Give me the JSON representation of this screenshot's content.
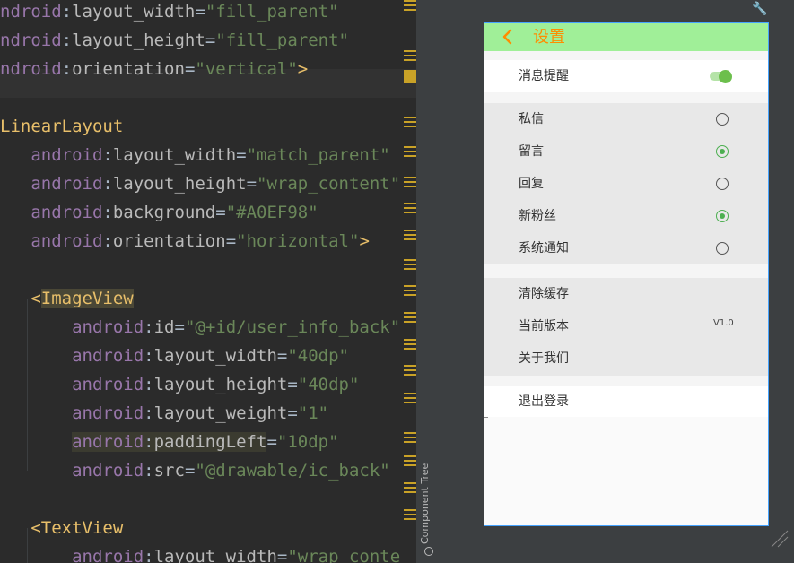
{
  "editor": {
    "lines": [
      [
        {
          "c": "ns",
          "t": "ndroid"
        },
        {
          "c": "",
          "t": ":"
        },
        {
          "c": "attr",
          "t": "layout_width"
        },
        {
          "c": "",
          "t": "="
        },
        {
          "c": "str",
          "t": "\"fill_parent\""
        }
      ],
      [
        {
          "c": "ns",
          "t": "ndroid"
        },
        {
          "c": "",
          "t": ":"
        },
        {
          "c": "attr",
          "t": "layout_height"
        },
        {
          "c": "",
          "t": "="
        },
        {
          "c": "str",
          "t": "\"fill_parent\""
        }
      ],
      [
        {
          "c": "ns",
          "t": "ndroid"
        },
        {
          "c": "",
          "t": ":"
        },
        {
          "c": "attr",
          "t": "orientation"
        },
        {
          "c": "",
          "t": "="
        },
        {
          "c": "str",
          "t": "\"vertical\""
        },
        {
          "c": "tag",
          "t": ">"
        }
      ],
      [],
      [
        {
          "c": "tagname",
          "t": "LinearLayout"
        }
      ],
      [
        {
          "c": "",
          "t": "   "
        },
        {
          "c": "ns",
          "t": "android"
        },
        {
          "c": "",
          "t": ":"
        },
        {
          "c": "attr",
          "t": "layout_width"
        },
        {
          "c": "",
          "t": "="
        },
        {
          "c": "str",
          "t": "\"match_parent\""
        }
      ],
      [
        {
          "c": "",
          "t": "   "
        },
        {
          "c": "ns",
          "t": "android"
        },
        {
          "c": "",
          "t": ":"
        },
        {
          "c": "attr",
          "t": "layout_height"
        },
        {
          "c": "",
          "t": "="
        },
        {
          "c": "str",
          "t": "\"wrap_content\""
        }
      ],
      [
        {
          "c": "",
          "t": "   "
        },
        {
          "c": "ns",
          "t": "android"
        },
        {
          "c": "",
          "t": ":"
        },
        {
          "c": "attr",
          "t": "background"
        },
        {
          "c": "",
          "t": "="
        },
        {
          "c": "str",
          "t": "\"#A0EF98\""
        }
      ],
      [
        {
          "c": "",
          "t": "   "
        },
        {
          "c": "ns",
          "t": "android"
        },
        {
          "c": "",
          "t": ":"
        },
        {
          "c": "attr",
          "t": "orientation"
        },
        {
          "c": "",
          "t": "="
        },
        {
          "c": "str",
          "t": "\"horizontal\""
        },
        {
          "c": "tag",
          "t": ">"
        }
      ],
      [],
      [
        {
          "c": "",
          "t": "   "
        },
        {
          "c": "tag",
          "t": "<"
        },
        {
          "c": "tagname hl-tag",
          "t": "ImageView"
        }
      ],
      [
        {
          "c": "",
          "t": "       "
        },
        {
          "c": "ns",
          "t": "android"
        },
        {
          "c": "",
          "t": ":"
        },
        {
          "c": "attr",
          "t": "id"
        },
        {
          "c": "",
          "t": "="
        },
        {
          "c": "str",
          "t": "\"@+id/user_info_back\""
        }
      ],
      [
        {
          "c": "",
          "t": "       "
        },
        {
          "c": "ns",
          "t": "android"
        },
        {
          "c": "",
          "t": ":"
        },
        {
          "c": "attr",
          "t": "layout_width"
        },
        {
          "c": "",
          "t": "="
        },
        {
          "c": "str",
          "t": "\"40dp\""
        }
      ],
      [
        {
          "c": "",
          "t": "       "
        },
        {
          "c": "ns",
          "t": "android"
        },
        {
          "c": "",
          "t": ":"
        },
        {
          "c": "attr",
          "t": "layout_height"
        },
        {
          "c": "",
          "t": "="
        },
        {
          "c": "str",
          "t": "\"40dp\""
        }
      ],
      [
        {
          "c": "",
          "t": "       "
        },
        {
          "c": "ns",
          "t": "android"
        },
        {
          "c": "",
          "t": ":"
        },
        {
          "c": "attr",
          "t": "layout_weight"
        },
        {
          "c": "",
          "t": "="
        },
        {
          "c": "str",
          "t": "\"1\""
        }
      ],
      [
        {
          "c": "",
          "t": "       "
        },
        {
          "c": "ns hl-attr",
          "t": "android"
        },
        {
          "c": "hl-attr",
          "t": ":"
        },
        {
          "c": "attr hl-attr",
          "t": "paddingLeft"
        },
        {
          "c": "",
          "t": "="
        },
        {
          "c": "str",
          "t": "\"10dp\""
        }
      ],
      [
        {
          "c": "",
          "t": "       "
        },
        {
          "c": "ns",
          "t": "android"
        },
        {
          "c": "",
          "t": ":"
        },
        {
          "c": "attr",
          "t": "src"
        },
        {
          "c": "",
          "t": "="
        },
        {
          "c": "str",
          "t": "\"@drawable/ic_back\""
        }
      ],
      [],
      [
        {
          "c": "",
          "t": "   "
        },
        {
          "c": "tag",
          "t": "<"
        },
        {
          "c": "tagname",
          "t": "TextView"
        }
      ],
      [
        {
          "c": "",
          "t": "       "
        },
        {
          "c": "ns",
          "t": "android"
        },
        {
          "c": "",
          "t": ":"
        },
        {
          "c": "attr",
          "t": "layout_width"
        },
        {
          "c": "",
          "t": "="
        },
        {
          "c": "str",
          "t": "\"wrap_conte"
        }
      ]
    ]
  },
  "side_panel": {
    "label": "Component Tree"
  },
  "preview": {
    "toolbar": {
      "title": "设置",
      "bg_color": "#A0EF98",
      "title_color": "#FF8C00"
    },
    "notification": {
      "label": "消息提醒",
      "enabled": true
    },
    "options": [
      {
        "label": "私信",
        "selected": false
      },
      {
        "label": "留言",
        "selected": true
      },
      {
        "label": "回复",
        "selected": false
      },
      {
        "label": "新粉丝",
        "selected": true
      },
      {
        "label": "系统通知",
        "selected": false
      }
    ],
    "misc": [
      {
        "label": "清除缓存"
      },
      {
        "label": "当前版本",
        "value": "V1.0"
      },
      {
        "label": "关于我们"
      }
    ],
    "logout": {
      "label": "退出登录"
    }
  }
}
